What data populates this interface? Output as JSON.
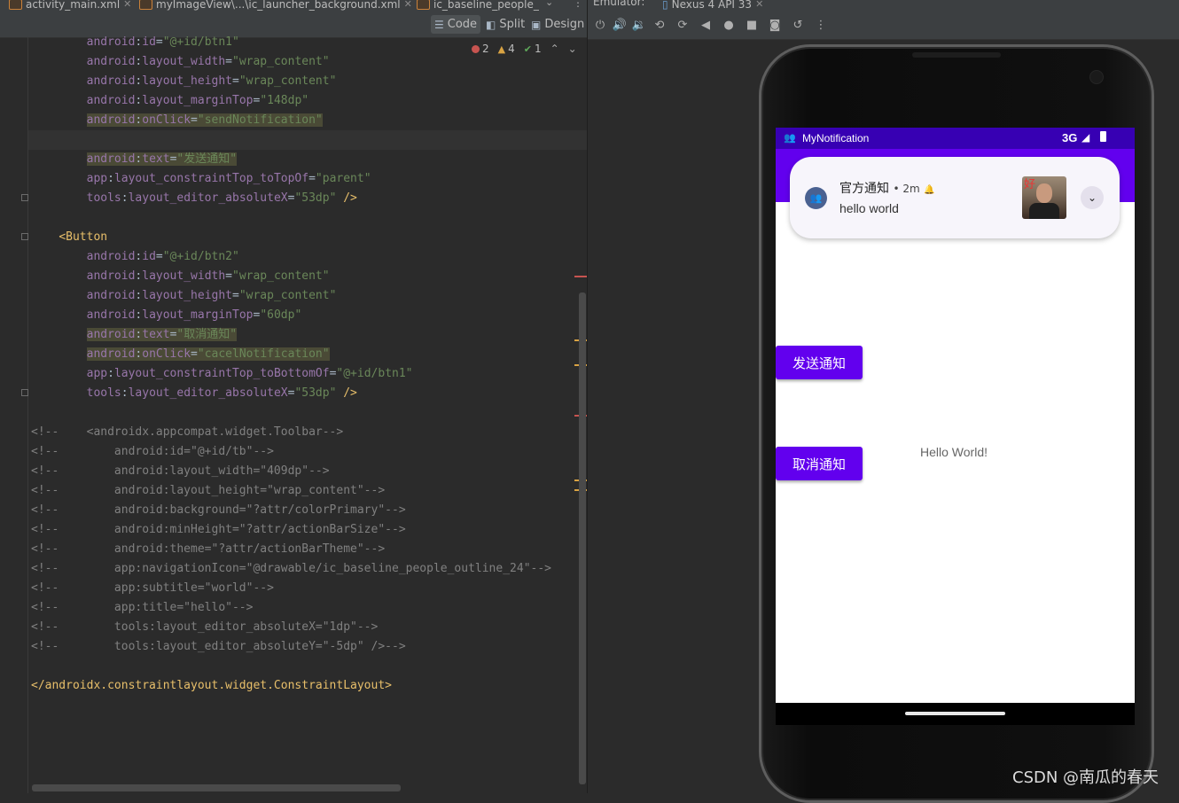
{
  "editor": {
    "tabs": [
      {
        "label": "activity_main.xml"
      },
      {
        "label": "myImageView\\...\\ic_launcher_background.xml"
      },
      {
        "label": "ic_baseline_people_"
      }
    ],
    "views": {
      "code": "Code",
      "split": "Split",
      "design": "Design"
    },
    "inspections": {
      "errors": "2",
      "warnings": "4",
      "ok": "1"
    },
    "lines": [
      {
        "parts": [
          [
            "ns",
            "android"
          ],
          [
            "plain",
            ":"
          ],
          [
            "attr",
            "id"
          ],
          [
            "plain",
            "="
          ],
          [
            "str",
            "\"@+id/btn1\""
          ]
        ],
        "indent": "        "
      },
      {
        "parts": [
          [
            "ns",
            "android"
          ],
          [
            "plain",
            ":"
          ],
          [
            "attr",
            "layout_width"
          ],
          [
            "plain",
            "="
          ],
          [
            "str",
            "\"wrap_content\""
          ]
        ],
        "indent": "        "
      },
      {
        "parts": [
          [
            "ns",
            "android"
          ],
          [
            "plain",
            ":"
          ],
          [
            "attr",
            "layout_height"
          ],
          [
            "plain",
            "="
          ],
          [
            "str",
            "\"wrap_content\""
          ]
        ],
        "indent": "        "
      },
      {
        "parts": [
          [
            "ns",
            "android"
          ],
          [
            "plain",
            ":"
          ],
          [
            "attr",
            "layout_marginTop"
          ],
          [
            "plain",
            "="
          ],
          [
            "str",
            "\"148dp\""
          ]
        ],
        "indent": "        "
      },
      {
        "parts": [
          [
            "ns",
            "android"
          ],
          [
            "plain",
            ":"
          ],
          [
            "attr",
            "onClick"
          ],
          [
            "plain",
            "="
          ],
          [
            "str",
            "\"sendNotification\""
          ]
        ],
        "indent": "        ",
        "hl": true
      },
      {
        "parts": [],
        "indent": ""
      },
      {
        "parts": [
          [
            "ns",
            "android"
          ],
          [
            "plain",
            ":"
          ],
          [
            "attr",
            "text"
          ],
          [
            "plain",
            "="
          ],
          [
            "str",
            "\"发送通知\""
          ]
        ],
        "indent": "        ",
        "hl": true
      },
      {
        "parts": [
          [
            "ns",
            "app"
          ],
          [
            "plain",
            ":"
          ],
          [
            "attr",
            "layout_constraintTop_toTopOf"
          ],
          [
            "plain",
            "="
          ],
          [
            "str",
            "\"parent\""
          ]
        ],
        "indent": "        "
      },
      {
        "parts": [
          [
            "ns",
            "tools"
          ],
          [
            "plain",
            ":"
          ],
          [
            "attr",
            "layout_editor_absoluteX"
          ],
          [
            "plain",
            "="
          ],
          [
            "str",
            "\"53dp\""
          ],
          [
            "tag",
            " />"
          ]
        ],
        "indent": "        "
      },
      {
        "parts": [],
        "indent": ""
      },
      {
        "parts": [
          [
            "tag",
            "<Button"
          ]
        ],
        "indent": "    "
      },
      {
        "parts": [
          [
            "ns",
            "android"
          ],
          [
            "plain",
            ":"
          ],
          [
            "attr",
            "id"
          ],
          [
            "plain",
            "="
          ],
          [
            "str",
            "\"@+id/btn2\""
          ]
        ],
        "indent": "        "
      },
      {
        "parts": [
          [
            "ns",
            "android"
          ],
          [
            "plain",
            ":"
          ],
          [
            "attr",
            "layout_width"
          ],
          [
            "plain",
            "="
          ],
          [
            "str",
            "\"wrap_content\""
          ]
        ],
        "indent": "        "
      },
      {
        "parts": [
          [
            "ns",
            "android"
          ],
          [
            "plain",
            ":"
          ],
          [
            "attr",
            "layout_height"
          ],
          [
            "plain",
            "="
          ],
          [
            "str",
            "\"wrap_content\""
          ]
        ],
        "indent": "        "
      },
      {
        "parts": [
          [
            "ns",
            "android"
          ],
          [
            "plain",
            ":"
          ],
          [
            "attr",
            "layout_marginTop"
          ],
          [
            "plain",
            "="
          ],
          [
            "str",
            "\"60dp\""
          ]
        ],
        "indent": "        "
      },
      {
        "parts": [
          [
            "ns",
            "android"
          ],
          [
            "plain",
            ":"
          ],
          [
            "attr",
            "text"
          ],
          [
            "plain",
            "="
          ],
          [
            "str",
            "\"取消通知\""
          ]
        ],
        "indent": "        ",
        "hl": true
      },
      {
        "parts": [
          [
            "ns",
            "android"
          ],
          [
            "plain",
            ":"
          ],
          [
            "attr",
            "onClick"
          ],
          [
            "plain",
            "="
          ],
          [
            "str",
            "\"cacelNotification\""
          ]
        ],
        "indent": "        ",
        "hl": true
      },
      {
        "parts": [
          [
            "ns",
            "app"
          ],
          [
            "plain",
            ":"
          ],
          [
            "attr",
            "layout_constraintTop_toBottomOf"
          ],
          [
            "plain",
            "="
          ],
          [
            "str",
            "\"@+id/btn1\""
          ]
        ],
        "indent": "        "
      },
      {
        "parts": [
          [
            "ns",
            "tools"
          ],
          [
            "plain",
            ":"
          ],
          [
            "attr",
            "layout_editor_absoluteX"
          ],
          [
            "plain",
            "="
          ],
          [
            "str",
            "\"53dp\""
          ],
          [
            "tag",
            " />"
          ]
        ],
        "indent": "        "
      },
      {
        "parts": [],
        "indent": ""
      },
      {
        "parts": [
          [
            "cmt",
            "<!--    <androidx.appcompat.widget.Toolbar-->"
          ]
        ],
        "indent": ""
      },
      {
        "parts": [
          [
            "cmt",
            "<!--        android:id=\"@+id/tb\"-->"
          ]
        ],
        "indent": ""
      },
      {
        "parts": [
          [
            "cmt",
            "<!--        android:layout_width=\"409dp\"-->"
          ]
        ],
        "indent": ""
      },
      {
        "parts": [
          [
            "cmt",
            "<!--        android:layout_height=\"wrap_content\"-->"
          ]
        ],
        "indent": ""
      },
      {
        "parts": [
          [
            "cmt",
            "<!--        android:background=\"?attr/colorPrimary\"-->"
          ]
        ],
        "indent": ""
      },
      {
        "parts": [
          [
            "cmt",
            "<!--        android:minHeight=\"?attr/actionBarSize\"-->"
          ]
        ],
        "indent": ""
      },
      {
        "parts": [
          [
            "cmt",
            "<!--        android:theme=\"?attr/actionBarTheme\"-->"
          ]
        ],
        "indent": ""
      },
      {
        "parts": [
          [
            "cmt",
            "<!--        app:navigationIcon=\"@drawable/ic_baseline_people_outline_24\"-->"
          ]
        ],
        "indent": ""
      },
      {
        "parts": [
          [
            "cmt",
            "<!--        app:subtitle=\"world\"-->"
          ]
        ],
        "indent": ""
      },
      {
        "parts": [
          [
            "cmt",
            "<!--        app:title=\"hello\"-->"
          ]
        ],
        "indent": ""
      },
      {
        "parts": [
          [
            "cmt",
            "<!--        tools:layout_editor_absoluteX=\"1dp\"-->"
          ]
        ],
        "indent": ""
      },
      {
        "parts": [
          [
            "cmt",
            "<!--        tools:layout_editor_absoluteY=\"-5dp\" />-->"
          ]
        ],
        "indent": ""
      },
      {
        "parts": [],
        "indent": ""
      },
      {
        "parts": [
          [
            "tag",
            "</androidx.constraintlayout.widget.ConstraintLayout>"
          ]
        ],
        "indent": ""
      }
    ]
  },
  "emulator": {
    "tab_prefix": "Emulator:",
    "device_tab": "Nexus 4 API 33",
    "tools": [
      "power-icon",
      "volume-up-icon",
      "volume-down-icon",
      "rotate-left-icon",
      "rotate-right-icon",
      "back-icon",
      "home-icon",
      "overview-icon",
      "screenshot-icon",
      "snapshot-icon",
      "more-icon"
    ]
  },
  "phone": {
    "status": {
      "app_name": "MyNotification",
      "network": "3G"
    },
    "notification": {
      "title": "官方通知",
      "time": "• 2m",
      "text": "hello world",
      "thumb_watermark": "好"
    },
    "buttons": {
      "send": "发送通知",
      "cancel": "取消通知"
    },
    "hello": "Hello World!"
  },
  "watermark": "CSDN @南瓜的春天",
  "colors": {
    "primary": "#6200ee",
    "primary_dark": "#3700b3",
    "editor_bg": "#2b2b2b"
  }
}
